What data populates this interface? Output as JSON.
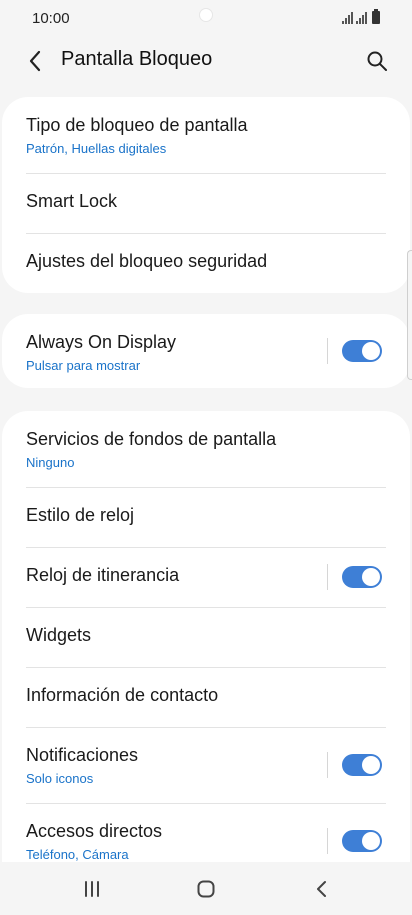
{
  "status_bar": {
    "time": "10:00"
  },
  "header": {
    "title": "Pantalla Bloqueo",
    "back_icon": "chevron-left-icon",
    "search_icon": "search-icon"
  },
  "sections": {
    "lock": {
      "items": [
        {
          "title": "Tipo de bloqueo de pantalla",
          "subtitle": "Patrón, Huellas digitales"
        },
        {
          "title": "Smart Lock"
        },
        {
          "title": "Ajustes del bloqueo seguridad"
        }
      ]
    },
    "aod": {
      "items": [
        {
          "title": "Always On Display",
          "subtitle": "Pulsar para mostrar",
          "toggle_on": true
        }
      ]
    },
    "other": {
      "items": [
        {
          "title": "Servicios de fondos de pantalla",
          "subtitle": "Ninguno"
        },
        {
          "title": "Estilo de reloj"
        },
        {
          "title": "Reloj de itinerancia",
          "toggle_on": true
        },
        {
          "title": "Widgets"
        },
        {
          "title": "Información de contacto"
        },
        {
          "title": "Notificaciones",
          "subtitle": "Solo iconos",
          "toggle_on": true
        },
        {
          "title": "Accesos directos",
          "subtitle": "Teléfono, Cámara",
          "toggle_on": true
        }
      ]
    }
  },
  "nav_bar": {
    "recents_icon": "recents-icon",
    "home_icon": "home-icon",
    "back_icon": "back-icon"
  },
  "colors": {
    "accent": "#3e7fd6",
    "subtitle": "#1a73c9",
    "background": "#f5f5f5",
    "card": "#ffffff"
  }
}
